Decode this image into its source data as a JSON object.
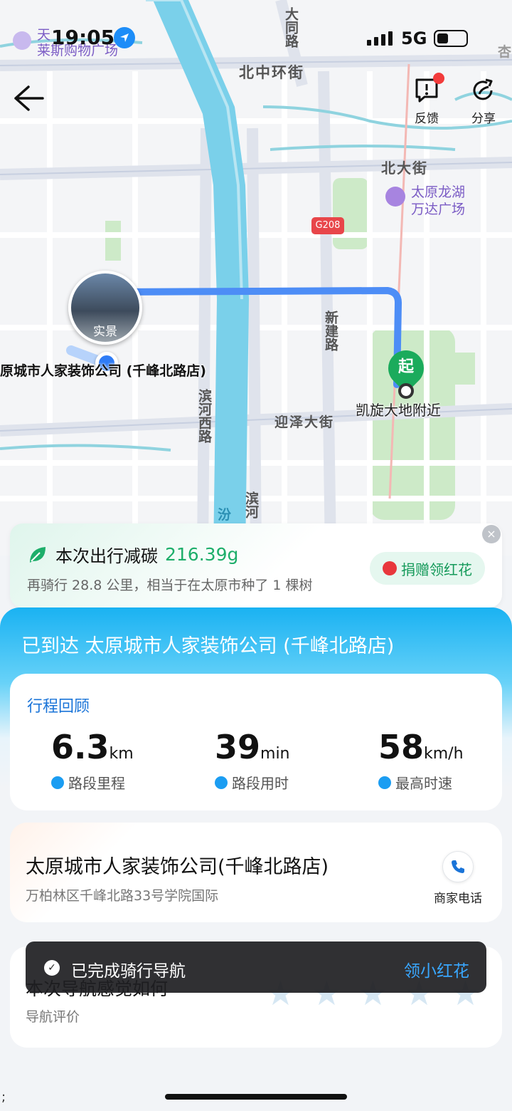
{
  "status_bar": {
    "time": "19:05",
    "network": "5G",
    "overlay_poi_line1": "天",
    "overlay_poi_line2": "莱斯购物广场"
  },
  "nav": {
    "feedback_label": "反馈",
    "share_label": "分享"
  },
  "map": {
    "roads": {
      "bei_zhong_huan": "北中环街",
      "bei_da": "北大街",
      "ying_ze": "迎泽大街",
      "da_tong": "大同路",
      "xin_jian": "新建路",
      "bin_he_xi": "滨河西路",
      "bin_he_2": "滨河",
      "fen": "汾",
      "edge_char": "杏",
      "g208": "G208"
    },
    "poi_line1": "太原龙湖",
    "poi_line2": "万达广场",
    "live_view_label": "实景",
    "destination_label": "原城市人家装饰公司 (千峰北路店)",
    "start_badge": "起",
    "start_label": "凯旋大地附近",
    "route_color": "#4d8df6"
  },
  "carbon": {
    "title": "本次出行减碳",
    "amount": "216.39g",
    "subtitle": "再骑行 28.8 公里，相当于在太原市种了 1 棵树",
    "donate_label": "捐赠领红花",
    "close_label": "×"
  },
  "result": {
    "arrived_text": "已到达 太原城市人家装饰公司 (千峰北路店)",
    "review_title": "行程回顾",
    "stats": [
      {
        "value": "6.3",
        "unit": "km",
        "caption": "路段里程"
      },
      {
        "value": "39",
        "unit": "min",
        "caption": "路段用时"
      },
      {
        "value": "58",
        "unit": "km/h",
        "caption": "最高时速"
      }
    ]
  },
  "shop": {
    "name": "太原城市人家装饰公司(千峰北路店)",
    "address": "万柏林区千峰北路33号学院国际",
    "phone_label": "商家电话"
  },
  "rating": {
    "title": "本次导航感觉如何",
    "subtitle": "导航评价",
    "star_count": 5,
    "star_glyph": "★"
  },
  "toast": {
    "message": "已完成骑行导航",
    "action": "领小红花",
    "check": "✓"
  },
  "stray_char": ";"
}
